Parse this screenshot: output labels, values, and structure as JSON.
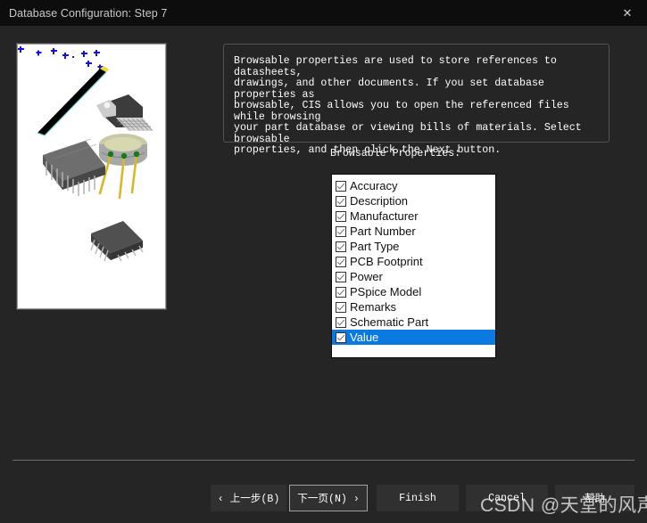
{
  "window": {
    "title": "Database Configuration: Step 7",
    "close_label": "✕",
    "bg_color": "#252525",
    "titlebar_color": "#0d0d0d"
  },
  "instruction": {
    "text": "Browsable properties are used to store references to datasheets,\ndrawings, and other documents. If you set database properties as\nbrowsable, CIS allows you to open the referenced files while browsing\nyour part database or viewing bills of materials. Select browsable\nproperties, and then click the Next button."
  },
  "properties": {
    "label": "Browsable Properties:",
    "selected_color": "#0a7ae0",
    "items": [
      {
        "label": "Accuracy",
        "checked": true,
        "selected": false
      },
      {
        "label": "Description",
        "checked": true,
        "selected": false
      },
      {
        "label": "Manufacturer",
        "checked": true,
        "selected": false
      },
      {
        "label": "Part Number",
        "checked": true,
        "selected": false
      },
      {
        "label": "Part Type",
        "checked": true,
        "selected": false
      },
      {
        "label": "PCB Footprint",
        "checked": true,
        "selected": false
      },
      {
        "label": "Power",
        "checked": true,
        "selected": false
      },
      {
        "label": "PSpice Model",
        "checked": true,
        "selected": false
      },
      {
        "label": "Remarks",
        "checked": true,
        "selected": false
      },
      {
        "label": "Schematic Part",
        "checked": true,
        "selected": false
      },
      {
        "label": "Value",
        "checked": true,
        "selected": true
      }
    ]
  },
  "buttons": {
    "back": "‹ 上一步(B)",
    "next": "下一页(N) ›",
    "finish": "Finish",
    "cancel": "Cancel",
    "help": "帮助"
  },
  "watermark": {
    "text": "CSDN @天堂的风声"
  },
  "preview_image": {
    "description": "magic-wand-and-electronic-components",
    "background": "#ffffff",
    "sparkle_color": "#1414d2",
    "wand_color": "#000000",
    "wand_tip_color": "#f2e232"
  }
}
